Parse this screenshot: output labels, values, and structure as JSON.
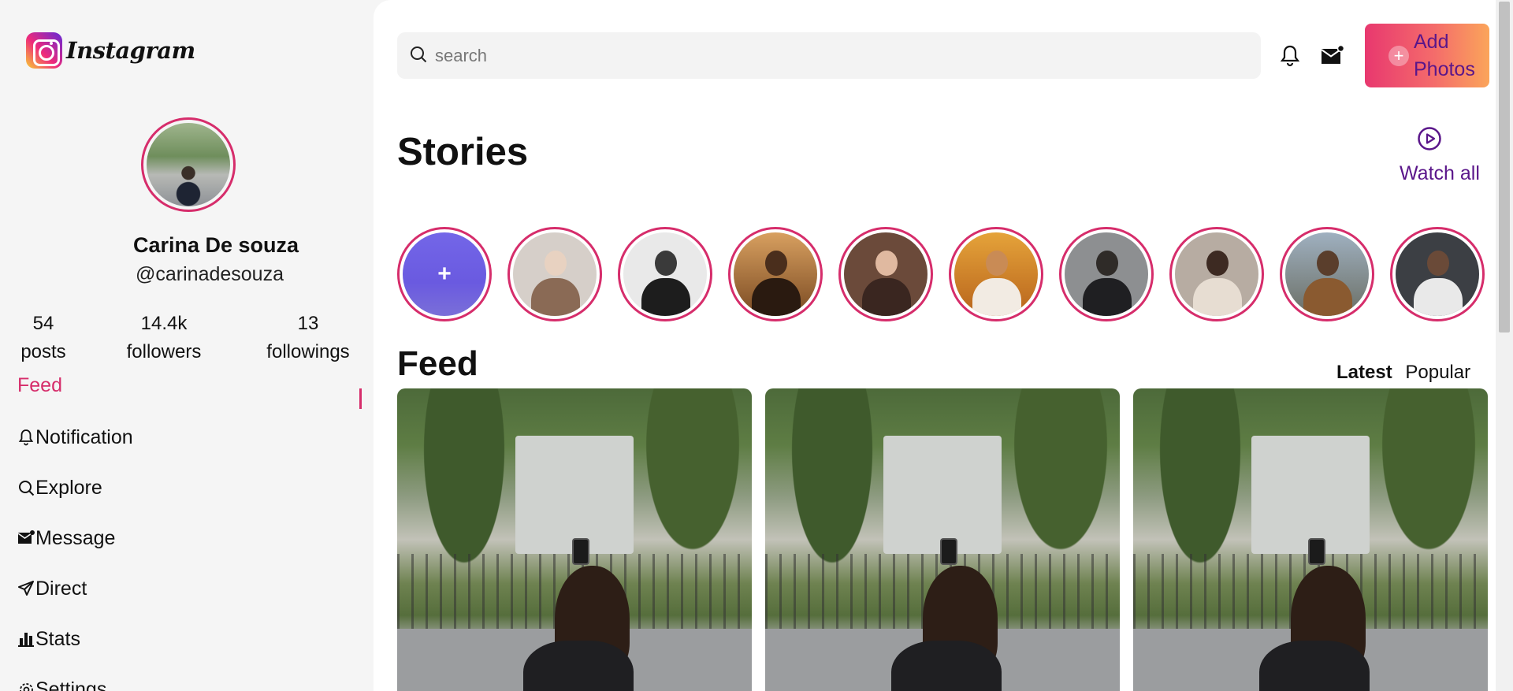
{
  "app": {
    "logo_text": "Instagram"
  },
  "profile": {
    "name": "Carina De souza",
    "handle": "@carinadesouza",
    "stats": [
      {
        "value": "54",
        "label": "posts"
      },
      {
        "value": "14.4k",
        "label": "followers"
      },
      {
        "value": "13",
        "label": "followings"
      }
    ]
  },
  "nav": {
    "items": [
      {
        "label": "Feed",
        "icon": "none",
        "active": true
      },
      {
        "label": "Notification",
        "icon": "bell-icon"
      },
      {
        "label": "Explore",
        "icon": "search-icon"
      },
      {
        "label": "Message",
        "icon": "mail-icon"
      },
      {
        "label": "Direct",
        "icon": "send-icon"
      },
      {
        "label": "Stats",
        "icon": "bar-chart-icon"
      },
      {
        "label": "Settings",
        "icon": "gear-icon"
      }
    ]
  },
  "header": {
    "search_placeholder": "search",
    "add_photos_label": "Add Photos"
  },
  "stories": {
    "title": "Stories",
    "watch_all": "Watch all",
    "add_symbol": "+",
    "count": 10
  },
  "feed": {
    "title": "Feed",
    "tabs": [
      "Latest",
      "Popular"
    ],
    "active_tab": "Latest",
    "post_count": 3
  },
  "colors": {
    "accent_pink": "#d62d6b",
    "accent_purple": "#5a168a",
    "button_gradient_start": "#e8386f",
    "button_gradient_end": "#fba55a"
  }
}
